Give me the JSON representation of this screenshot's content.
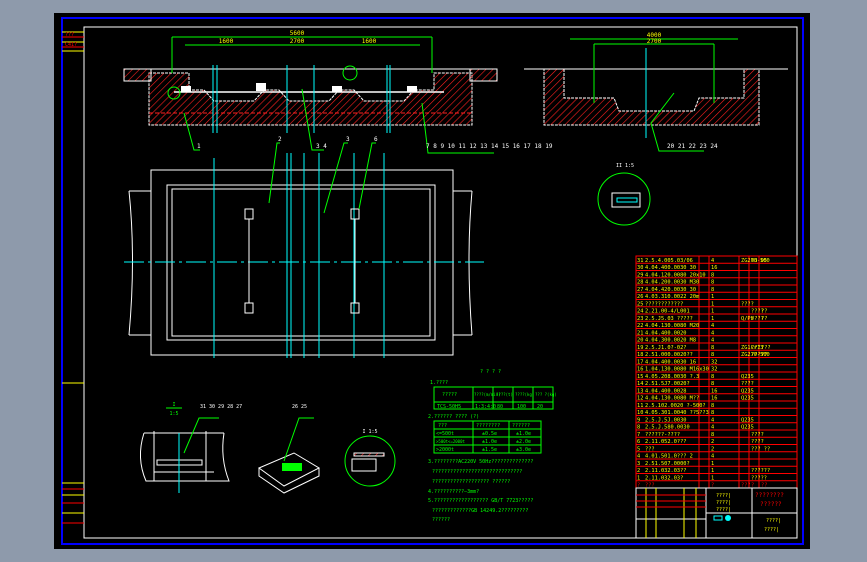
{
  "colors": {
    "background": "#8e9aab",
    "canvas": "#000000",
    "frame": "#0000ff",
    "line": "#ffffff",
    "hatch": "#ff2020",
    "leader": "#00ff00",
    "center": "#00e0ff",
    "text": "#ffff00",
    "table": "#ff0000"
  },
  "left_strip": {
    "labels": [
      "???",
      "C41?"
    ]
  },
  "top_section": {
    "dim_total": "5600",
    "dim_inner": "2700",
    "dim_left": "1600",
    "dim_right": "1600",
    "balloons": [
      "1",
      "2",
      "3",
      "4",
      "5",
      "6",
      "7",
      "8",
      "9",
      "10",
      "11",
      "12",
      "13",
      "14",
      "15",
      "16",
      "17",
      "18",
      "19"
    ]
  },
  "right_section": {
    "dim_total": "4000",
    "dim_inner": "2700",
    "balloons": [
      "20",
      "21",
      "22",
      "23",
      "24"
    ],
    "detail_label": "II 1:5"
  },
  "plan_balloons": [
    "2",
    "3",
    "6"
  ],
  "detail_left": {
    "scale_num": "I",
    "scale_den": "1:5",
    "balloons": "31 30 29 28 27"
  },
  "detail_mid": {
    "balloons": "26 25"
  },
  "detail_right": {
    "label": "I 1:5"
  },
  "notes": {
    "title": "? ? ? ?",
    "n1": "1.????",
    "table1": {
      "headers": [
        "?????",
        "????(m/min)",
        "????(t)",
        "????(kg)",
        "??? ?(kg)"
      ],
      "row": [
        "TCS-50H5",
        "1:3:4:0",
        "80",
        "100",
        "20"
      ]
    },
    "n2": "2.?????? ????  (?)",
    "table2": {
      "headers": [
        "???",
        "????????",
        "??????"
      ],
      "rows": [
        [
          "<=500t",
          "±0.5e",
          "±1.0e"
        ],
        [
          ">500t<=2000t",
          "±1.0e",
          "±2.0e"
        ],
        [
          ">2000t",
          "±1.5e",
          "±3.0e"
        ]
      ]
    },
    "n3": "3.????????AC220V  50Hz??????????????",
    "n3b": "??????????????????????????????",
    "n3c": "??????????????????? ??????",
    "n4": "4.??????????—3mm?",
    "n5": "5.?????????????????? GB/T 7723?????",
    "n5b": "?????????????GB 14249.2?????????",
    "n5c": "??????"
  },
  "bom": {
    "rows": [
      [
        "31",
        "2.5.4.005.03/06",
        "4",
        "ZG270-500",
        "03 05",
        ""
      ],
      [
        "30",
        "4.04.400.0030 30",
        "16",
        "",
        "",
        ""
      ],
      [
        "29",
        "4.04.120.0080 20x10",
        "8",
        "",
        "",
        ""
      ],
      [
        "28",
        "4.04.200.0030 M30",
        "8",
        "",
        "",
        ""
      ],
      [
        "27",
        "4.04.420.0030 30",
        "8",
        "",
        "",
        ""
      ],
      [
        "26",
        "4.03.310.0022 20m",
        "1",
        "",
        "",
        ""
      ],
      [
        "25",
        "????????????",
        "1",
        "????",
        "",
        ""
      ],
      [
        "24",
        "2.21.00-4/L001",
        "1",
        "",
        "????",
        "??"
      ],
      [
        "23",
        "2.5.J5.03 ?????",
        "1",
        "Q/Pb",
        "????",
        "??"
      ],
      [
        "22",
        "4.04.130.0080 M20",
        "4",
        "",
        "",
        ""
      ],
      [
        "21",
        "4.04.400.0020",
        "4",
        "",
        "",
        ""
      ],
      [
        "20",
        "4.04.300.0020 M8",
        "4",
        "",
        "",
        ""
      ],
      [
        "19",
        "2.5.J1.0?-02?",
        "8",
        "ZG1Cr13",
        "???",
        "???"
      ],
      [
        "18",
        "2.51.000.0020??",
        "8",
        "ZG270-500",
        "????",
        "??"
      ],
      [
        "17",
        "4.04.400.0030 16",
        "32",
        "",
        "",
        ""
      ],
      [
        "16",
        "1.04.130.0080 M16x30",
        "32",
        "",
        "",
        ""
      ],
      [
        "15",
        "4.05.208.0030 ?.3",
        "8",
        "Q235",
        "",
        ""
      ],
      [
        "14",
        "2.51.5J7.0020?",
        "8",
        "????",
        "",
        ""
      ],
      [
        "13",
        "4.04.400.0028",
        "16",
        "Q235",
        "",
        ""
      ],
      [
        "12",
        "4.04.130.0080 M??",
        "16",
        "Q235",
        "",
        ""
      ],
      [
        "11",
        "2.5.102.0020 ?-500?",
        "8",
        "",
        "",
        ""
      ],
      [
        "10",
        "4.05.301.0040 ??5??3",
        "8",
        "",
        "",
        ""
      ],
      [
        "9",
        "2.5.J.5J.0030",
        "4",
        "Q235",
        "",
        ""
      ],
      [
        "8",
        "2.5.J.580.0030",
        "4",
        "Q235",
        "",
        ""
      ],
      [
        "7",
        "??????-????",
        "8",
        "",
        "????",
        ""
      ],
      [
        "6",
        "2.11.052.0???",
        "2",
        "",
        "????",
        ""
      ],
      [
        "5",
        "???",
        "2",
        "",
        "??? ??",
        ""
      ],
      [
        "4",
        "4.01.501.0??? 2",
        "4",
        "",
        "",
        ""
      ],
      [
        "3",
        "2.51.507.0000?",
        "1",
        "",
        "",
        ""
      ],
      [
        "2",
        "2.11.032.03??",
        "1",
        "",
        "??????",
        ""
      ],
      [
        "1",
        "2.11.032.03?",
        "1",
        "",
        "?????",
        ""
      ]
    ],
    "header": [
      "?",
      "???",
      "?",
      "???",
      "?",
      "??"
    ]
  },
  "title_block": {
    "labels_left": [
      "????|",
      "????|",
      "????|"
    ],
    "title_red": "????????",
    "title_red2": "??????",
    "drawing_no": "????|",
    "name": "????|"
  }
}
